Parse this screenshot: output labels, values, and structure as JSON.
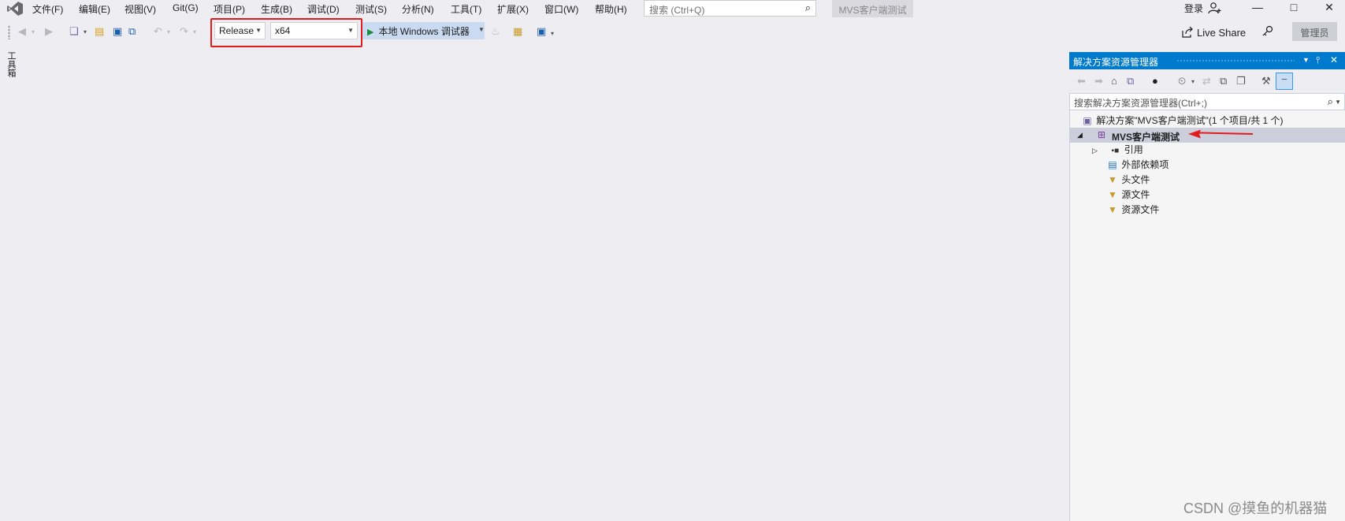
{
  "menubar": {
    "items": [
      "文件(F)",
      "编辑(E)",
      "视图(V)",
      "Git(G)",
      "项目(P)",
      "生成(B)",
      "调试(D)",
      "测试(S)",
      "分析(N)",
      "工具(T)",
      "扩展(X)",
      "窗口(W)",
      "帮助(H)"
    ],
    "search_placeholder": "搜索 (Ctrl+Q)",
    "solution_name": "MVS客户端测试",
    "login_label": "登录"
  },
  "toolbar": {
    "configuration": "Release",
    "platform": "x64",
    "run_label": "本地 Windows 调试器",
    "liveshare_label": "Live Share",
    "admin_label": "管理员"
  },
  "left_strip": {
    "toolbox_label": "工具箱"
  },
  "solution_explorer": {
    "title": "解决方案资源管理器",
    "search_placeholder": "搜索解决方案资源管理器(Ctrl+;)",
    "solution_node": "解决方案\"MVS客户端测试\"(1 个项目/共 1 个)",
    "project_node": "MVS客户端测试",
    "children": [
      "引用",
      "外部依赖项",
      "头文件",
      "源文件",
      "资源文件"
    ]
  },
  "watermark": "CSDN @摸鱼的机器猫",
  "colors": {
    "accent": "#007acc",
    "highlight_box": "#e21c1c",
    "selected_row": "#cccedb",
    "run_button_bg": "#c9daf1"
  }
}
